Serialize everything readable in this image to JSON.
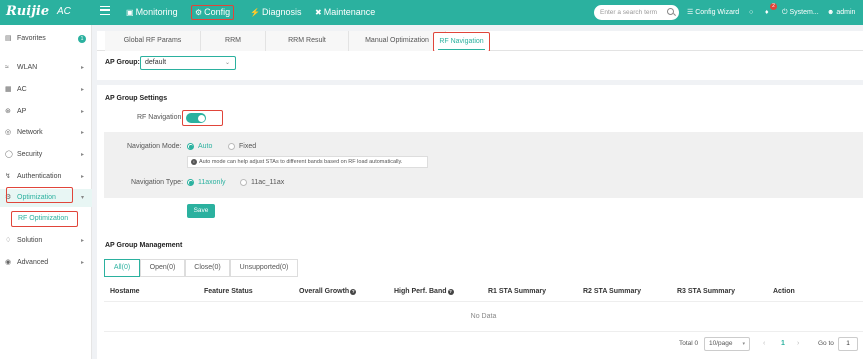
{
  "brand": {
    "logo": "Ruijie",
    "product": "AC"
  },
  "topnav": {
    "monitoring": "Monitoring",
    "config": "Config",
    "diagnosis": "Diagnosis",
    "maintenance": "Maintenance"
  },
  "search": {
    "placeholder": "Enter a search term"
  },
  "toolbar": {
    "config_wizard": "Config Wizard",
    "notification_count": "2",
    "system": "System...",
    "user": "admin"
  },
  "sidebar": {
    "items": [
      {
        "label": "Favorites",
        "icon": "bookmark-icon",
        "badge": "1"
      },
      {
        "label": "WLAN",
        "icon": "wifi-icon"
      },
      {
        "label": "AC",
        "icon": "ac-icon"
      },
      {
        "label": "AP",
        "icon": "ap-icon"
      },
      {
        "label": "Network",
        "icon": "network-icon"
      },
      {
        "label": "Security",
        "icon": "security-icon"
      },
      {
        "label": "Authentication",
        "icon": "authentication-icon"
      },
      {
        "label": "Optimization",
        "icon": "optimization-icon"
      },
      {
        "label": "Solution",
        "icon": "solution-icon"
      },
      {
        "label": "Advanced",
        "icon": "advanced-icon"
      }
    ],
    "sub_item": "RF Optimization"
  },
  "tabs": [
    {
      "label": "Global RF Params"
    },
    {
      "label": "RRM"
    },
    {
      "label": "RRM Result"
    },
    {
      "label": "Manual Optimization"
    },
    {
      "label": "RF Navigation",
      "active": true
    }
  ],
  "ap_group": {
    "label": "AP Group:",
    "value": "default"
  },
  "settings": {
    "title": "AP Group Settings",
    "rf_navigation_label": "RF Navigation:",
    "rf_navigation_on": true,
    "mode_label": "Navigation Mode:",
    "mode_options": [
      "Auto",
      "Fixed"
    ],
    "mode_selected": "Auto",
    "mode_hint": "Auto mode can help adjust STAs to different bands based on RF load automatically.",
    "type_label": "Navigation Type:",
    "type_options": [
      "11axonly",
      "11ac_11ax"
    ],
    "type_selected": "11axonly",
    "save": "Save"
  },
  "management": {
    "title": "AP Group Management",
    "filters": [
      "All(0)",
      "Open(0)",
      "Close(0)",
      "Unsupported(0)"
    ],
    "columns": [
      "Hostame",
      "Feature Status",
      "Overall Growth",
      "High Perf. Band",
      "R1 STA Summary",
      "R2 STA Summary",
      "R3 STA Summary",
      "Action"
    ],
    "empty": "No Data"
  },
  "pager": {
    "total": "Total 0",
    "page_size": "10/page",
    "current": "1",
    "goto_label": "Go to",
    "goto_value": "1"
  },
  "colors": {
    "accent": "#2bb19f",
    "highlight": "#e0453a"
  }
}
